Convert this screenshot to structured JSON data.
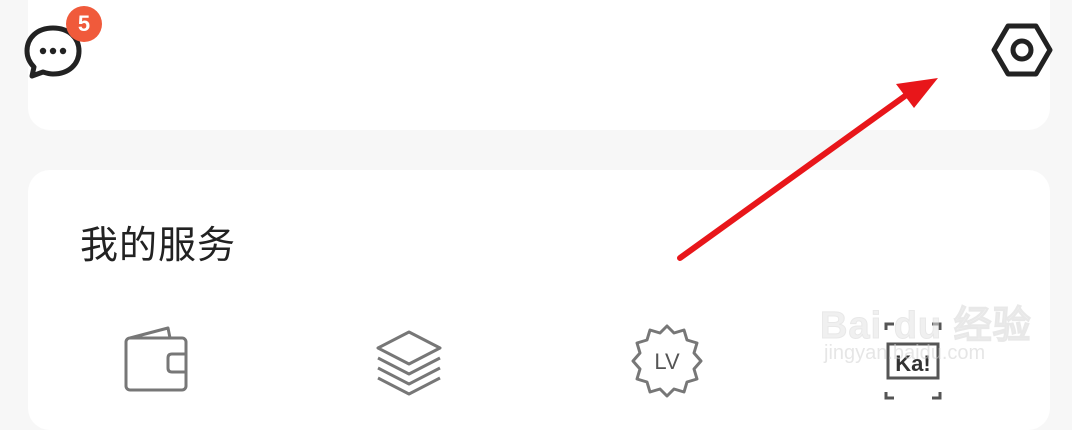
{
  "header": {
    "messages": {
      "icon": "chat-bubble-icon",
      "badge_count": "5",
      "badge_color": "#f05a3b"
    },
    "settings": {
      "icon": "settings-hexagon-icon"
    }
  },
  "services": {
    "title": "我的服务",
    "items": [
      {
        "icon": "wallet-icon"
      },
      {
        "icon": "layers-icon"
      },
      {
        "icon": "level-badge-icon",
        "icon_text": "LV"
      },
      {
        "icon": "card-scan-icon",
        "icon_text": "Ka!"
      }
    ]
  },
  "annotation": {
    "type": "arrow",
    "color": "#e8161a",
    "points_to": "settings"
  },
  "watermark": {
    "main": "Bai du 经验",
    "sub": "jingyan.baidu.com"
  }
}
